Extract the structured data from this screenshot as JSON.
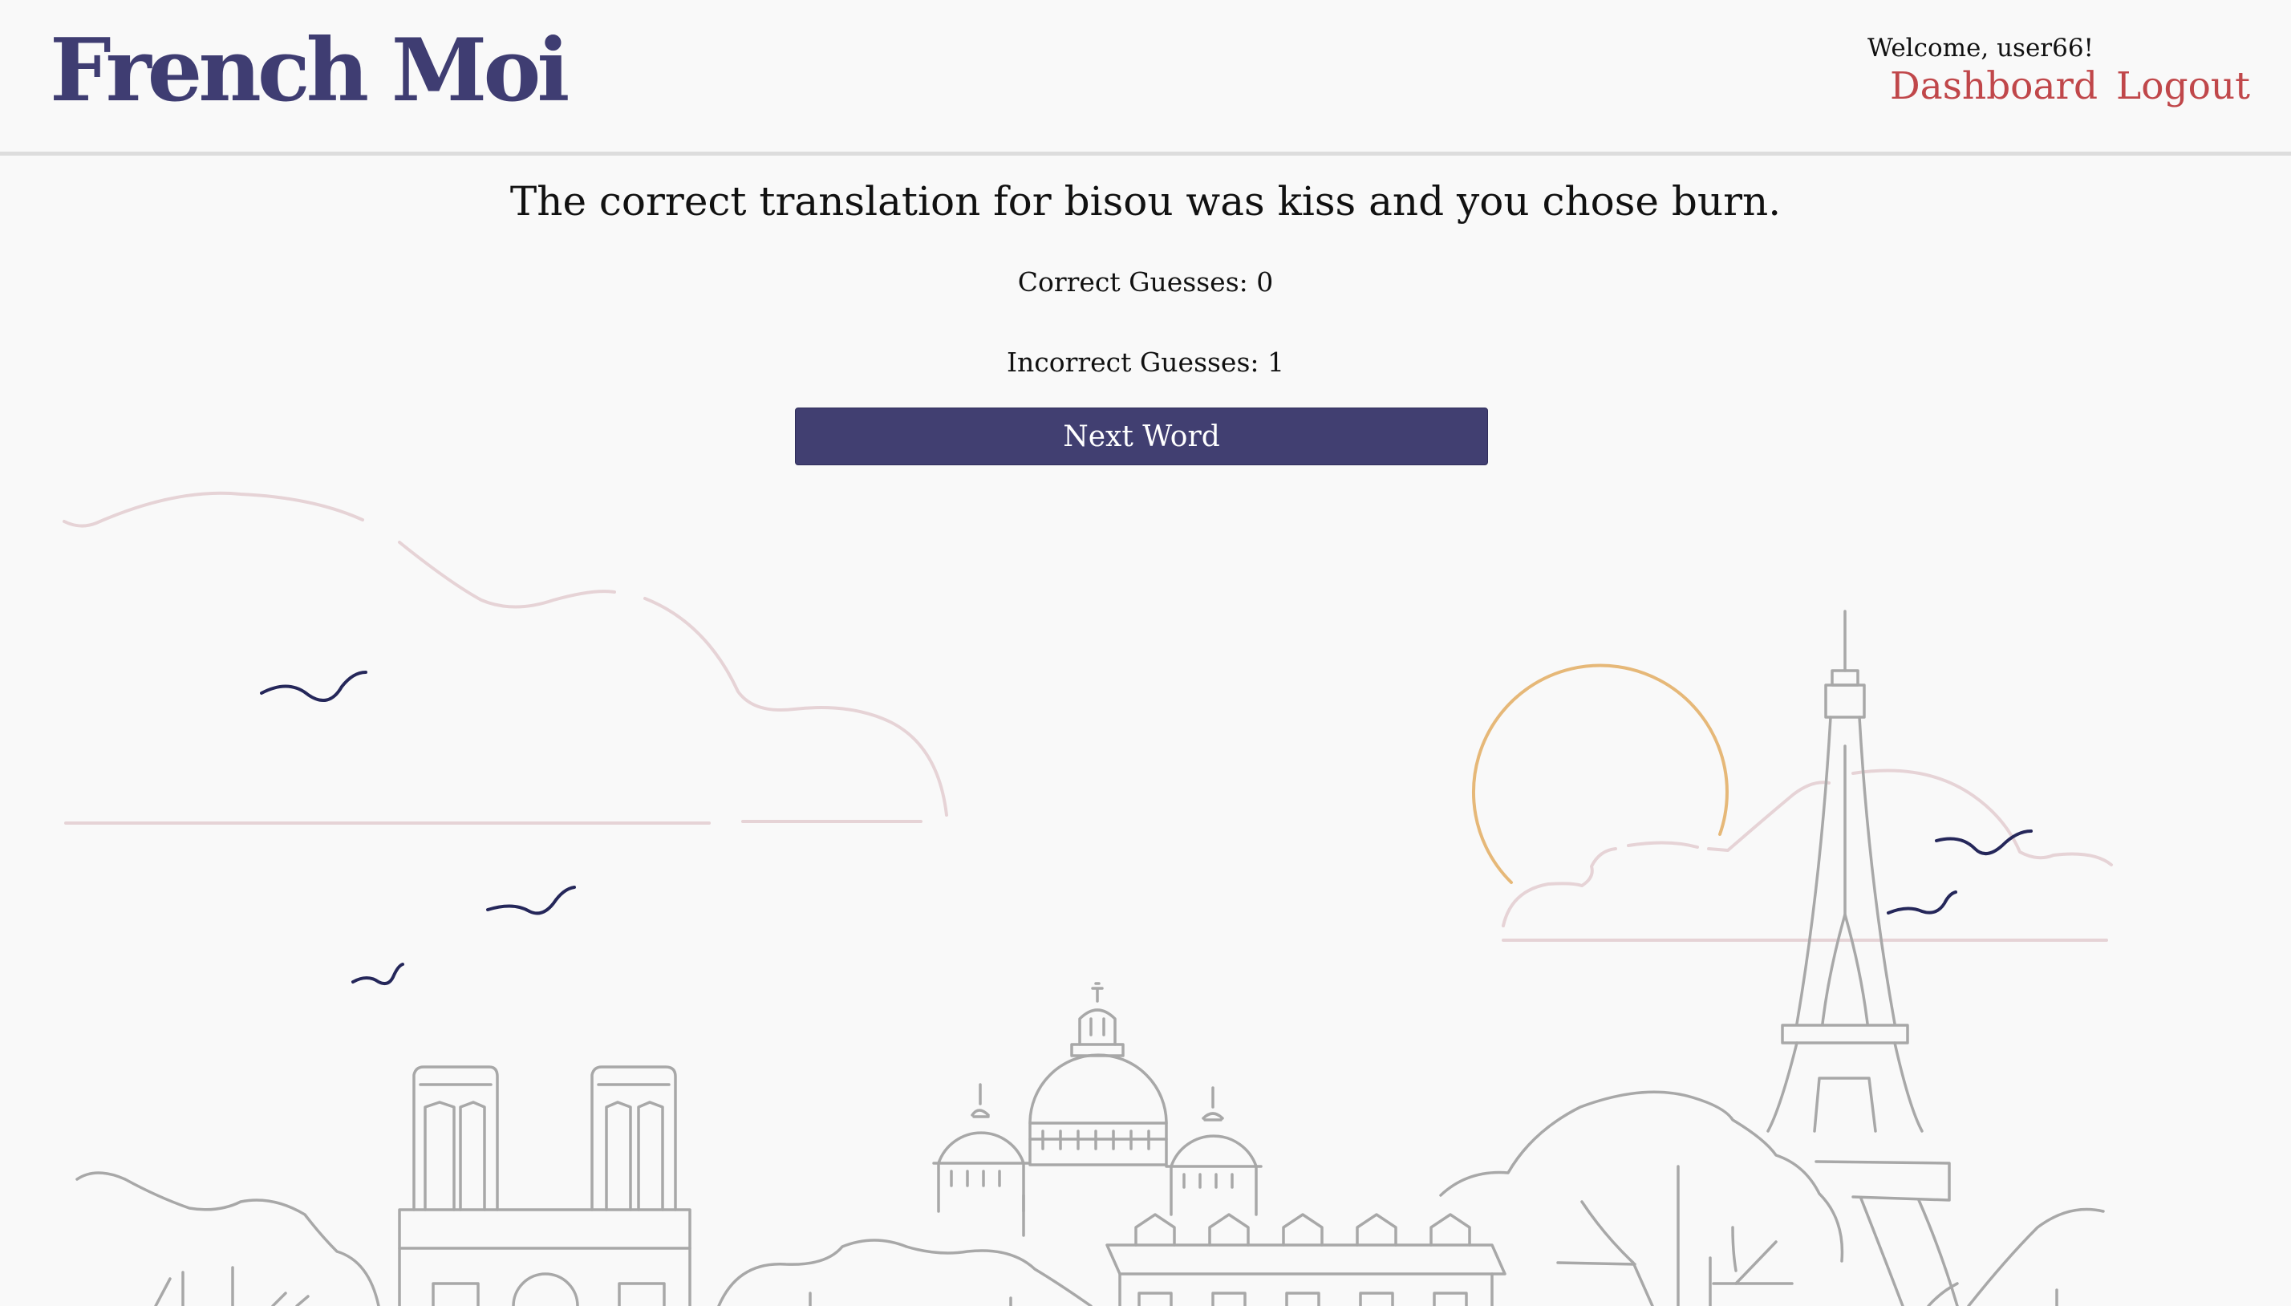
{
  "app": {
    "logo_text": "French Moi"
  },
  "header": {
    "welcome": "Welcome, user66!",
    "nav": {
      "dashboard": "Dashboard",
      "logout": "Logout"
    }
  },
  "quiz": {
    "result_message": "The correct translation for bisou was kiss and you chose burn.",
    "correct_guesses": "Correct Guesses: 0",
    "incorrect_guesses": "Incorrect Guesses: 1",
    "next_button": "Next Word"
  },
  "colors": {
    "brand": "#3f3d72",
    "nav_link": "#c0474a",
    "button_bg": "#413f71",
    "illustration_line": "#a8a8a8",
    "cloud_line": "#e6d3d6",
    "sun_line": "#e6b878",
    "bird_line": "#25275a"
  }
}
